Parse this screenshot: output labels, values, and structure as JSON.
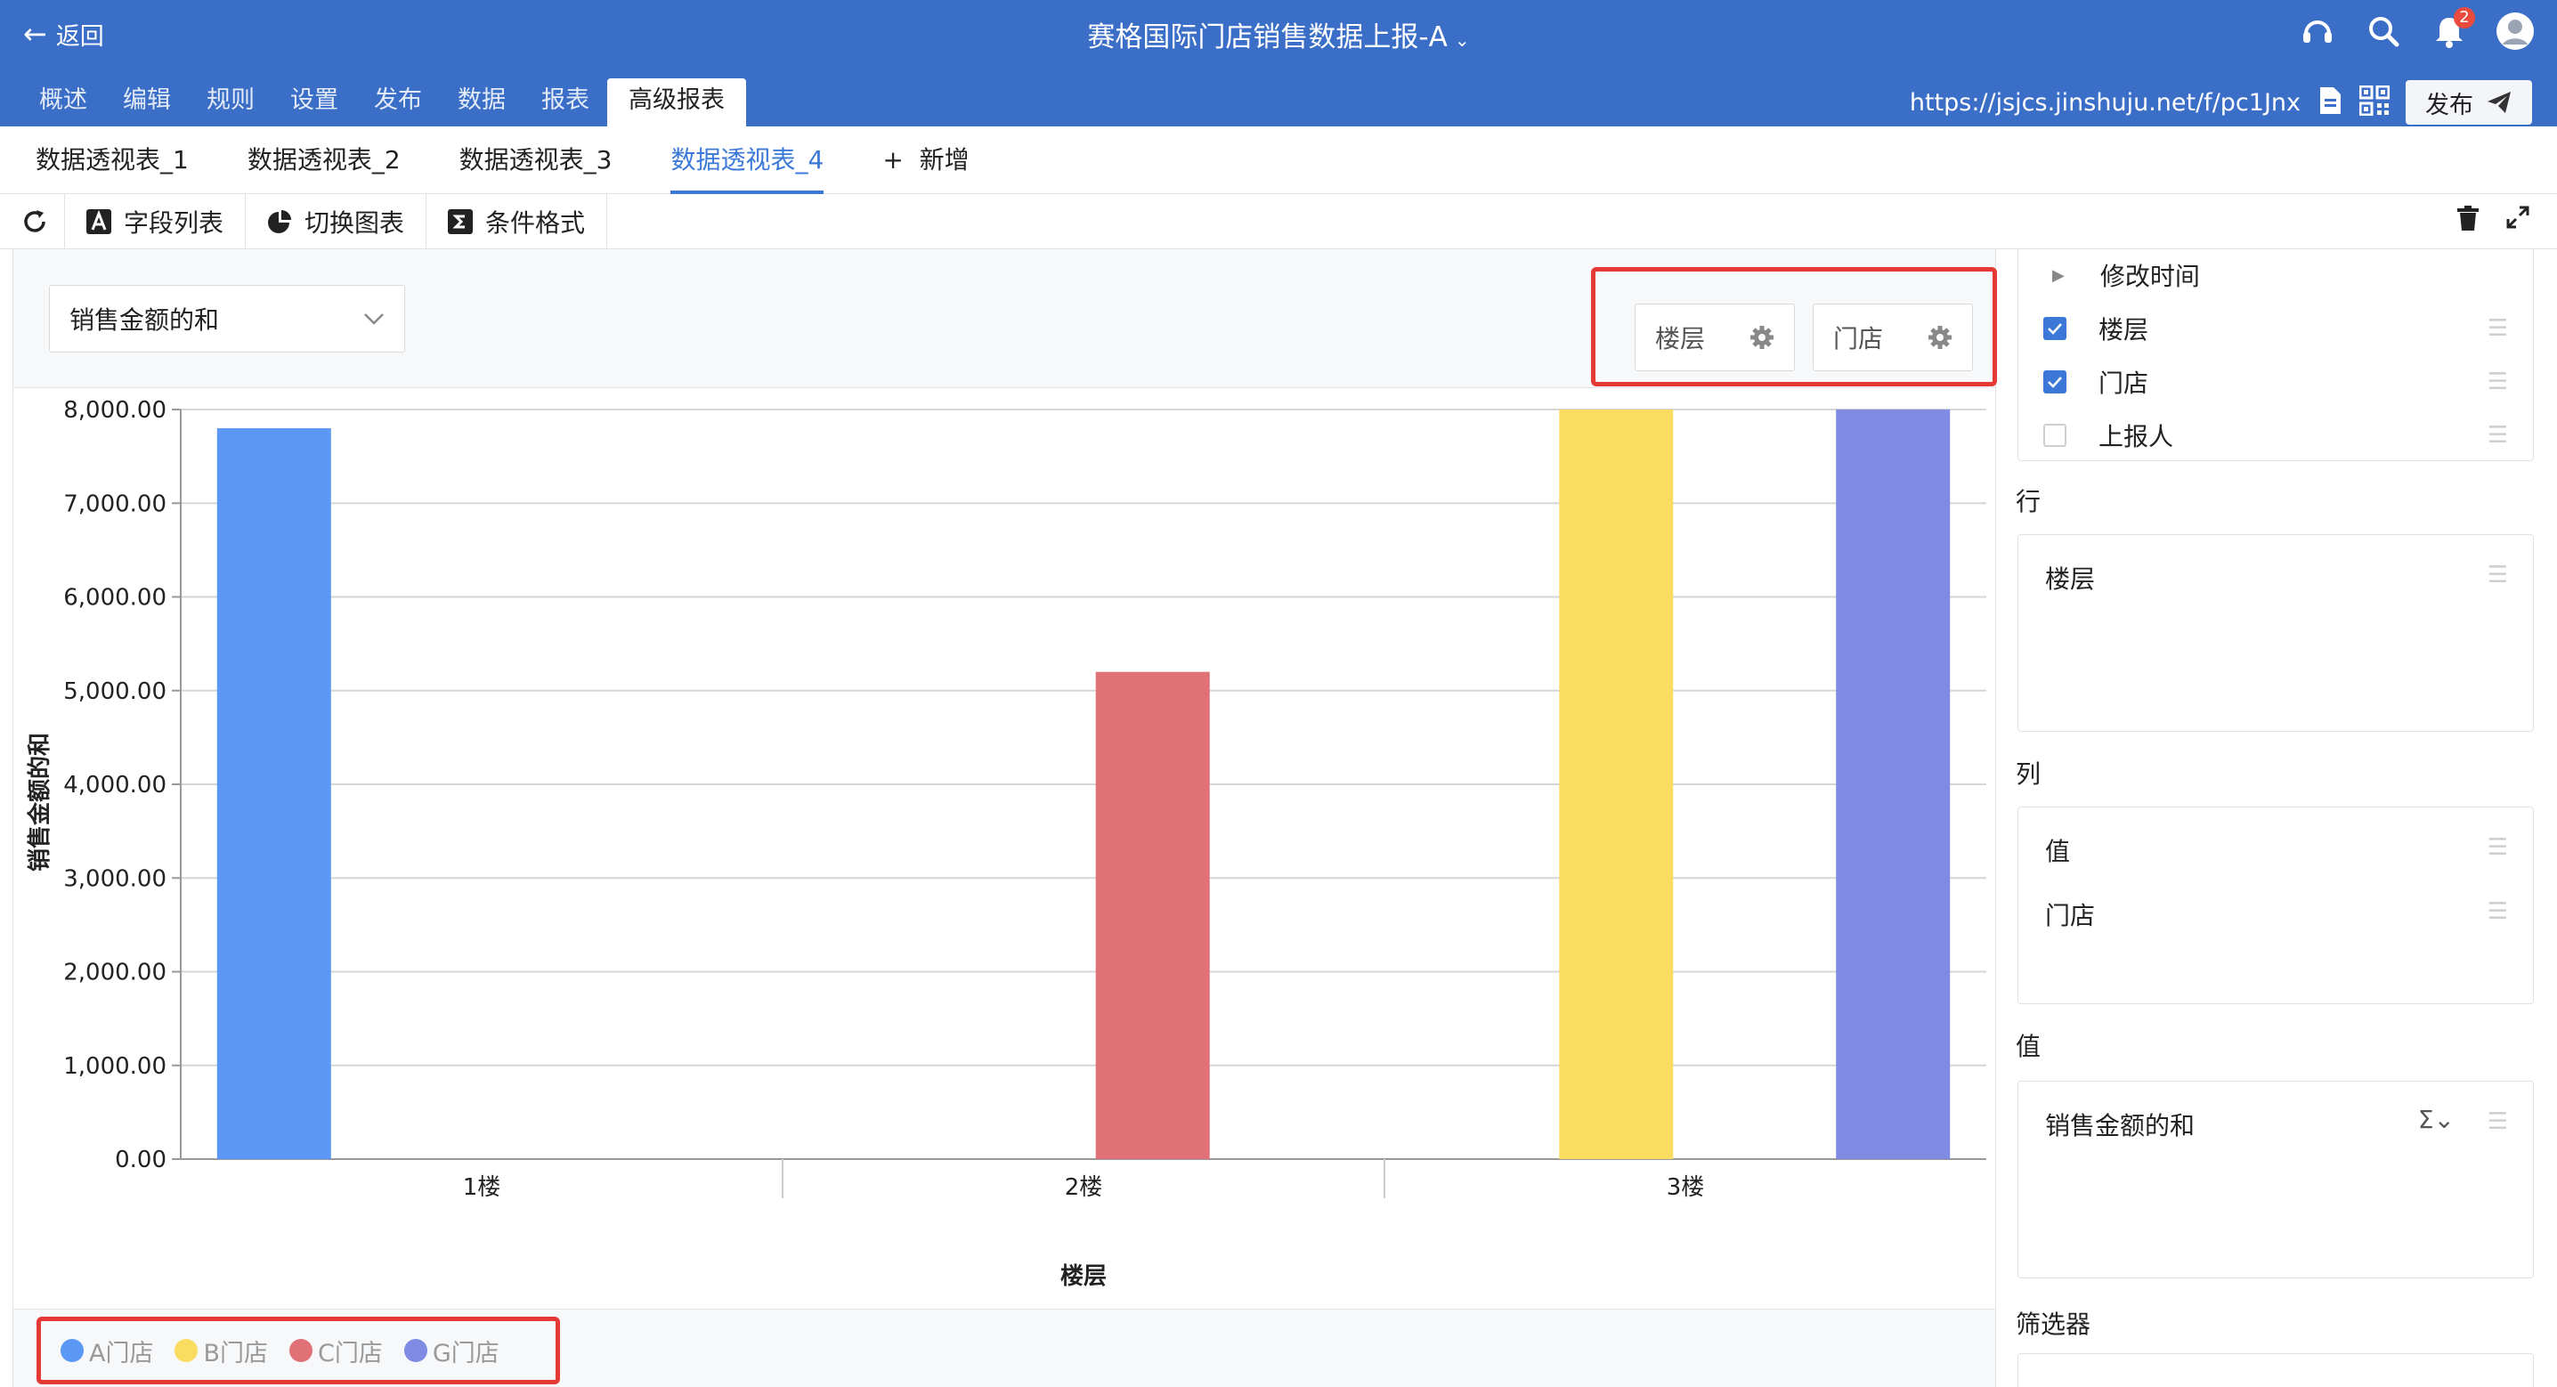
{
  "header": {
    "back_label": "返回",
    "title": "赛格国际门店销售数据上报-A",
    "notification_count": "2",
    "nav_tabs": [
      "概述",
      "编辑",
      "规则",
      "设置",
      "发布",
      "数据",
      "报表",
      "高级报表"
    ],
    "active_tab": "高级报表",
    "url": "https://jsjcs.jinshuju.net/f/pc1Jnx",
    "publish_label": "发布"
  },
  "pivot_tabs": [
    "数据透视表_1",
    "数据透视表_2",
    "数据透视表_3",
    "数据透视表_4"
  ],
  "active_pivot": "数据透视表_4",
  "add_label": "新增",
  "toolbar": {
    "field_list": "字段列表",
    "switch_chart": "切换图表",
    "conditional_format": "条件格式"
  },
  "measure_select": "销售金额的和",
  "filter_chips": [
    "楼层",
    "门店"
  ],
  "chart_data": {
    "type": "bar",
    "categories": [
      "1楼",
      "2楼",
      "3楼"
    ],
    "xlabel": "楼层",
    "ylabel": "销售金额的和",
    "ylim": [
      0,
      8000
    ],
    "yticks": [
      "0.00",
      "1,000.00",
      "2,000.00",
      "3,000.00",
      "4,000.00",
      "5,000.00",
      "6,000.00",
      "7,000.00",
      "8,000.00"
    ],
    "series": [
      {
        "name": "A门店",
        "color": "#5b97f5",
        "values": [
          7800,
          null,
          null
        ]
      },
      {
        "name": "B门店",
        "color": "#fadd60",
        "values": [
          null,
          null,
          8000
        ]
      },
      {
        "name": "C门店",
        "color": "#e07277",
        "values": [
          null,
          5200,
          null
        ]
      },
      {
        "name": "G门店",
        "color": "#7f8ae3",
        "values": [
          null,
          null,
          8000
        ]
      }
    ],
    "grid": true,
    "legend": "bottom-left"
  },
  "side": {
    "fields": [
      {
        "label": "修改时间",
        "type": "expand"
      },
      {
        "label": "楼层",
        "checked": true
      },
      {
        "label": "门店",
        "checked": true
      },
      {
        "label": "上报人",
        "checked": false
      }
    ],
    "rows_title": "行",
    "rows_items": [
      "楼层"
    ],
    "cols_title": "列",
    "cols_items": [
      "值",
      "门店"
    ],
    "values_title": "值",
    "values_items": [
      "销售金额的和"
    ],
    "filters_title": "筛选器"
  },
  "colors": {
    "header": "#3b6ec7",
    "accent": "#3b78d8",
    "highlight": "#e53935"
  }
}
